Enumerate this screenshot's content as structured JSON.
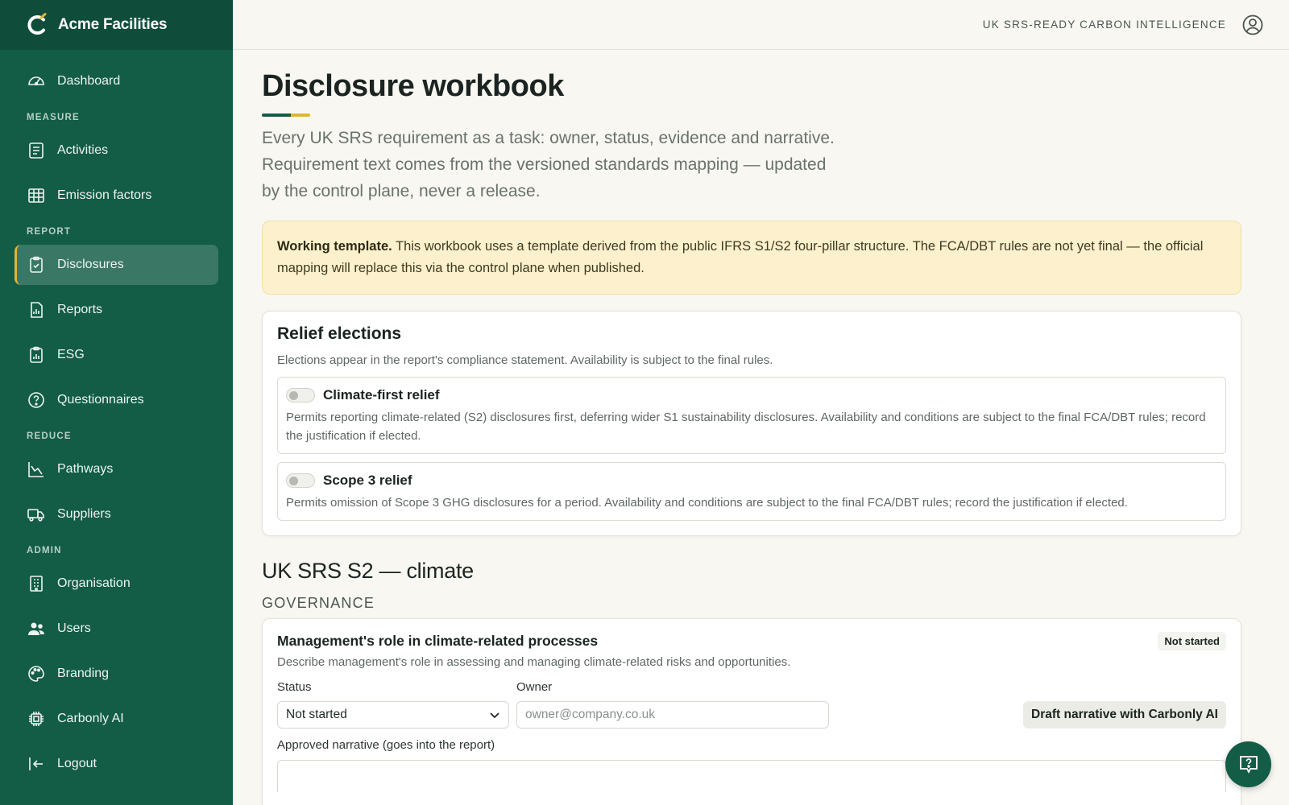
{
  "brand": {
    "name": "Acme Facilities"
  },
  "topbar": {
    "tag": "UK SRS-READY CARBON INTELLIGENCE"
  },
  "sidebar": {
    "dashboard": "Dashboard",
    "sections": {
      "measure": "MEASURE",
      "report": "REPORT",
      "reduce": "REDUCE",
      "admin": "ADMIN"
    },
    "items": {
      "activities": "Activities",
      "emission_factors": "Emission factors",
      "disclosures": "Disclosures",
      "reports": "Reports",
      "esg": "ESG",
      "questionnaires": "Questionnaires",
      "pathways": "Pathways",
      "suppliers": "Suppliers",
      "organisation": "Organisation",
      "users": "Users",
      "branding": "Branding",
      "carbonly_ai": "Carbonly AI",
      "logout": "Logout"
    },
    "active": "Disclosures"
  },
  "page": {
    "title": "Disclosure workbook",
    "subtitle": "Every UK SRS requirement as a task: owner, status, evidence and narrative. Requirement text comes from the versioned standards mapping — updated by the control plane, never a release."
  },
  "banner": {
    "bold": "Working template.",
    "text": " This workbook uses a template derived from the public IFRS S1/S2 four-pillar structure. The FCA/DBT rules are not yet final — the official mapping will replace this via the control plane when published."
  },
  "relief": {
    "title": "Relief elections",
    "description": "Elections appear in the report's compliance statement. Availability is subject to the final rules.",
    "items": [
      {
        "title": "Climate-first relief",
        "text": "Permits reporting climate-related (S2) disclosures first, deferring wider S1 sustainability disclosures. Availability and conditions are subject to the final FCA/DBT rules; record the justification if elected."
      },
      {
        "title": "Scope 3 relief",
        "text": "Permits omission of Scope 3 GHG disclosures for a period. Availability and conditions are subject to the final FCA/DBT rules; record the justification if elected."
      }
    ]
  },
  "section": {
    "title": "UK SRS S2 — climate",
    "pillar": "GOVERNANCE"
  },
  "requirement": {
    "title": "Management's role in climate-related processes",
    "badge": "Not started",
    "description": "Describe management's role in assessing and managing climate-related risks and opportunities.",
    "status_label": "Status",
    "status_value": "Not started",
    "owner_label": "Owner",
    "owner_placeholder": "owner@company.co.uk",
    "ai_button": "Draft narrative with Carbonly AI",
    "narrative_label": "Approved narrative (goes into the report)"
  },
  "colors": {
    "sidebar": "#135c46",
    "accent": "#e0b43a",
    "banner": "#fcf1cc"
  }
}
